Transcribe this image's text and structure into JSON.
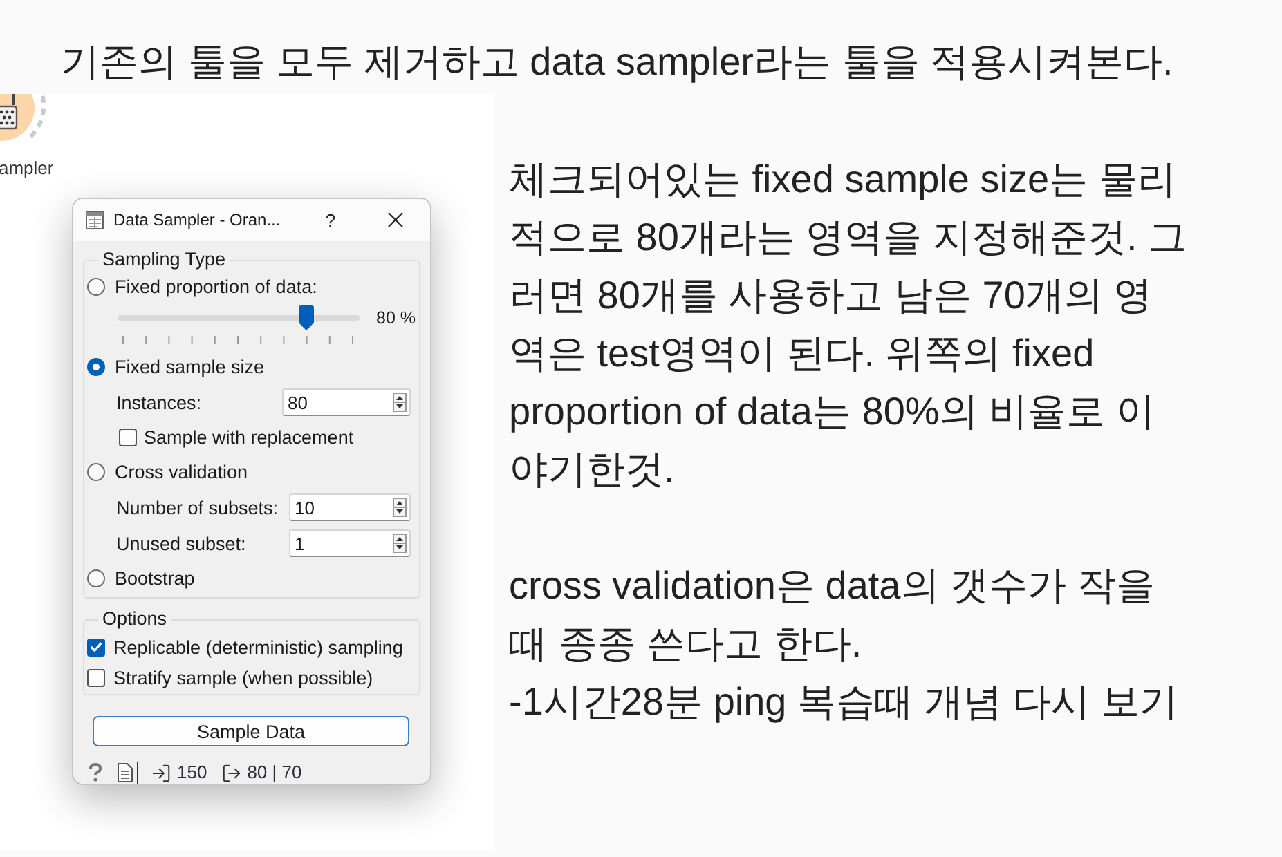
{
  "heading": "기존의 툴을 모두 제거하고 data sampler라는 툴을 적용시켜본다.",
  "canvas": {
    "node": {
      "label": "ampler"
    }
  },
  "dialog": {
    "title": "Data Sampler - Oran...",
    "help": "?",
    "sampling_type": {
      "title": "Sampling Type",
      "options": [
        {
          "label": "Fixed proportion of data:",
          "selected": false,
          "slider": {
            "level": 0.8,
            "reading": "80 %"
          }
        },
        {
          "label": "Fixed sample size",
          "selected": true,
          "fields": [
            {
              "label": "Instances:",
              "value": "80"
            }
          ],
          "checkboxes": [
            {
              "label": "Sample with replacement",
              "checked": false
            }
          ]
        },
        {
          "label": "Cross validation",
          "selected": false,
          "fields": [
            {
              "label": "Number of subsets:",
              "value": "10"
            },
            {
              "label": "Unused subset:",
              "value": "1"
            }
          ]
        },
        {
          "label": "Bootstrap",
          "selected": false
        }
      ]
    },
    "options": {
      "title": "Options",
      "checkboxes": [
        {
          "label": "Replicable (deterministic) sampling",
          "checked": true
        },
        {
          "label": "Stratify sample (when possible)",
          "checked": false
        }
      ]
    },
    "button": "Sample Data",
    "status_bar": {
      "input": "150",
      "output": "80 | 70"
    }
  },
  "notes": [
    {
      "paragraphs": [
        "체크되어있는 fixed sample size는 물리적으로 80개라는 영역을 지정해준것. 그러면 80개를 사용하고 남은 70개의 영역은 test영역이 된다. 위쪽의 fixed proportion of data는 80%의 비율로 이야기한것."
      ]
    },
    {
      "paragraphs": [
        "cross validation은 data의 갯수가 작을 때 종종 쓴다고 한다.",
        "-1시간28분 ping 복습때 개념 다시 보기"
      ]
    }
  ]
}
